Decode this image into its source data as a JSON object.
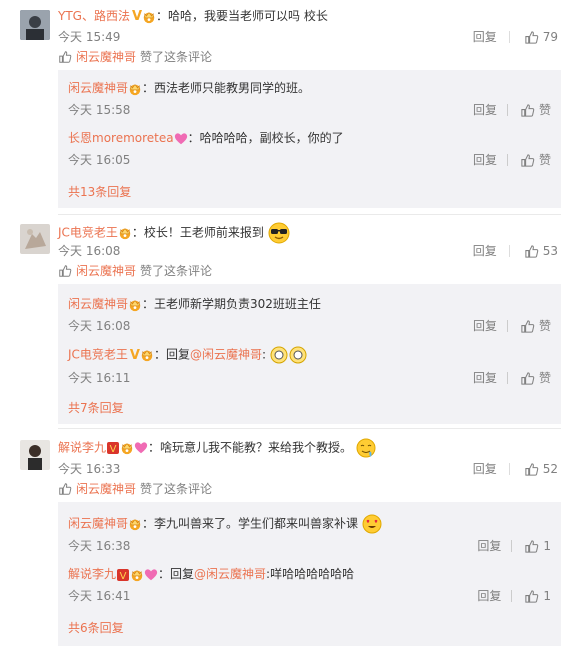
{
  "ui": {
    "reply": "回复",
    "like": "赞",
    "liked_by": "赞了这条评论",
    "self_name": "闲云魔神哥"
  },
  "c1": {
    "name": "YTG、路西法",
    "text": "：哈哈，我要当老师可以吗 校长",
    "time": "今天 15:49",
    "likes": "79",
    "replies": [
      {
        "name": "闲云魔神哥",
        "text": "：西法老师只能教男同学的班。",
        "time": "今天 15:58"
      },
      {
        "name": "长恩moremoretea",
        "text": "：哈哈哈哈，副校长，你的了",
        "time": "今天 16:05"
      }
    ],
    "more": "共13条回复"
  },
  "c2": {
    "name": "JC电竞老王",
    "text": "：校长！王老师前来报到",
    "time": "今天 16:08",
    "likes": "53",
    "replies": [
      {
        "name": "闲云魔神哥",
        "text": "：王老师新学期负责302班班主任",
        "time": "今天 16:08"
      },
      {
        "name": "JC电竞老王",
        "text": "：回复",
        "mention": "@闲云魔神哥",
        "after": ":",
        "time": "今天 16:11"
      }
    ],
    "more": "共7条回复"
  },
  "c3": {
    "name": "解说李九",
    "text": "：啥玩意儿我不能教？来给我个教授。",
    "time": "今天 16:33",
    "likes": "52",
    "replies": [
      {
        "name": "闲云魔神哥",
        "text": "：李九叫兽来了。学生们都来叫兽家补课",
        "time": "今天 16:38",
        "likes": "1"
      },
      {
        "name": "解说李九",
        "text": "：回复",
        "mention": "@闲云魔神哥",
        "after": ":咩哈哈哈哈哈哈",
        "time": "今天 16:41",
        "likes": "1"
      }
    ],
    "more": "共6条回复"
  },
  "colors": {
    "name": "#eb7350",
    "gray": "#808080",
    "sub_bg": "#f2f2f5",
    "heart": "#f06bb4",
    "vip": "#f5a623"
  }
}
